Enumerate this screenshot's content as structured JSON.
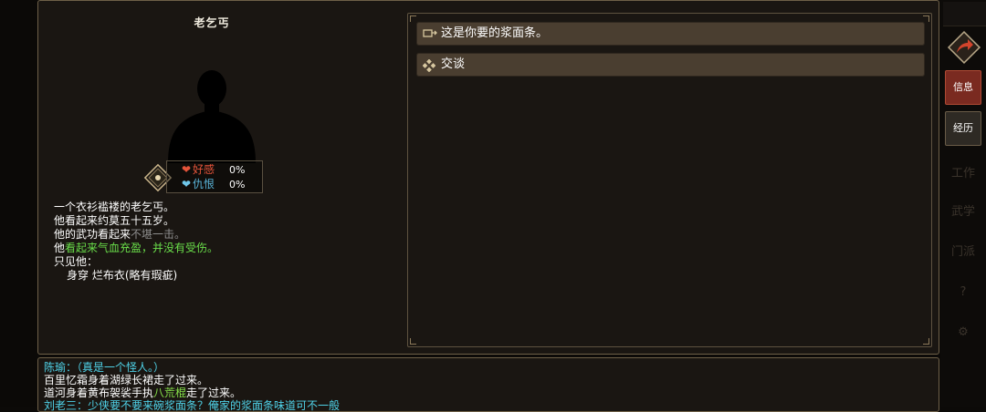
{
  "npc": {
    "name": "老乞丐",
    "relations": {
      "favor_label": "好感",
      "favor_value": "0%",
      "hatred_label": "仇恨",
      "hatred_value": "0%"
    }
  },
  "description": {
    "line1": "一个衣衫褴褛的老乞丐。",
    "line2": "他看起来约莫五十五岁。",
    "line3_prefix": "他的武功看起来",
    "line3_value": "不堪一击。",
    "line4_prefix": "他",
    "line4_value": "看起来气血充盈，并没有受伤。",
    "line5": "只见他：",
    "line6": "身穿 烂布衣(略有瑕疵)"
  },
  "dialog": {
    "options": [
      {
        "label": "这是你要的浆面条。",
        "icon": "give-item-icon"
      },
      {
        "label": "交谈",
        "icon": "talk-diamond-icon"
      }
    ]
  },
  "log": {
    "line1": "陈瑜：（真是一个怪人。）",
    "line2": "百里忆霜身着湖绿长裙走了过来。",
    "line3_prefix": "道河身着黄布袈裟手执",
    "line3_item": "八荒棍",
    "line3_suffix": "走了过来。",
    "line4": "刘老三：少侠要不要来碗浆面条？俺家的浆面条味道可不一般"
  },
  "sidebar": {
    "info_label": "信息",
    "exp_label": "经历",
    "dim1": "工作",
    "dim2": "武学",
    "dim3": "门派",
    "dim4": "?",
    "dim5": "⚙"
  },
  "colors": {
    "favor": "#e5543a",
    "hatred": "#5ab4d8",
    "highlight_green": "#6adf4a",
    "dialogue_cyan": "#4fd2e8",
    "active_tab": "#7a2a20"
  }
}
